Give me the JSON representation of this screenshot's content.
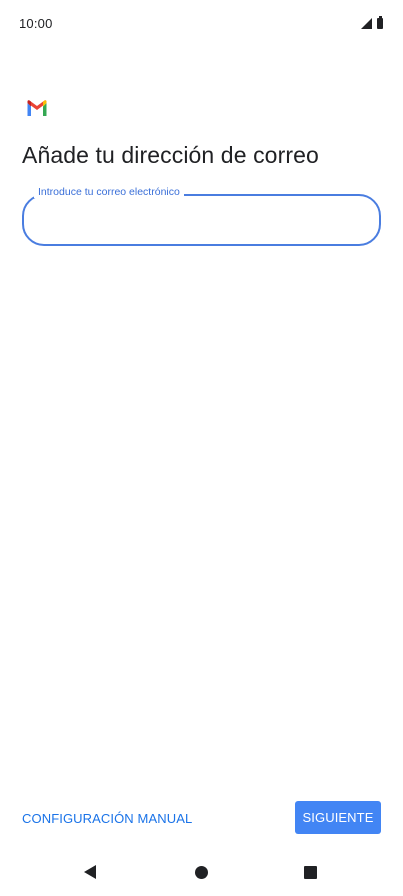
{
  "status_bar": {
    "time": "10:00",
    "icons": [
      "signal-icon",
      "battery-icon"
    ]
  },
  "app": {
    "logo": "gmail-logo",
    "colors": {
      "accent": "#4285f4",
      "link": "#1a73e8",
      "field_outline": "#4a7de0"
    }
  },
  "page": {
    "title": "Añade tu dirección de correo"
  },
  "email_field": {
    "label": "Introduce tu correo electrónico",
    "value": "",
    "placeholder": ""
  },
  "actions": {
    "manual_setup_label": "CONFIGURACIÓN MANUAL",
    "next_label": "SIGUIENTE"
  },
  "nav_bar": {
    "icons": [
      "back-icon",
      "home-icon",
      "recents-icon"
    ]
  }
}
